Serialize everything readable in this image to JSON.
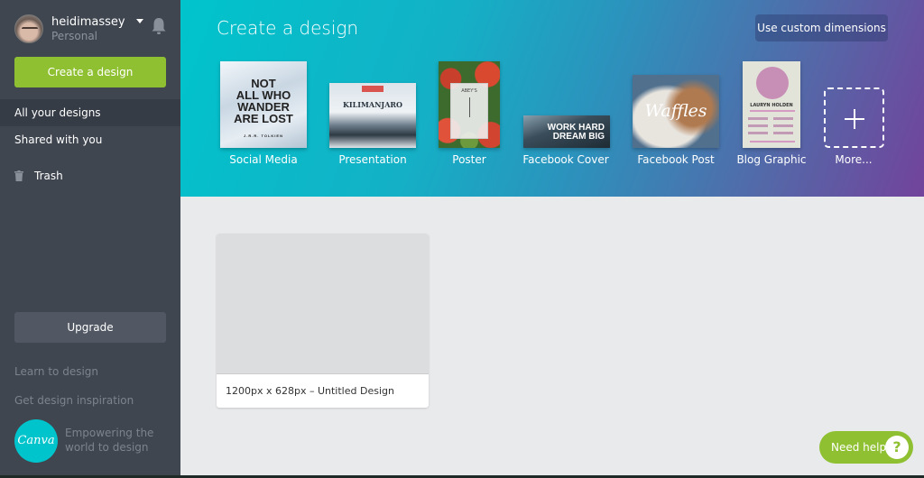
{
  "user": {
    "name": "heidimassey",
    "plan": "Personal"
  },
  "sidebar": {
    "create_label": "Create a design",
    "items": [
      {
        "label": "All your designs",
        "active": true
      },
      {
        "label": "Shared with you",
        "active": false
      },
      {
        "label": "Trash",
        "icon": "trash-icon"
      }
    ],
    "upgrade_label": "Upgrade",
    "links": [
      "Learn to design",
      "Get design inspiration"
    ],
    "logo_text": "Canva",
    "tagline": "Empowering the world to design"
  },
  "banner": {
    "title": "Create a design",
    "custom_dimensions_label": "Use custom dimensions",
    "templates": [
      {
        "label": "Social Media",
        "thumb_text": [
          "NOT",
          "ALL WHO",
          "WANDER",
          "ARE LOST"
        ],
        "thumb_sub": "J.R.R. TOLKIEN"
      },
      {
        "label": "Presentation",
        "thumb_text": "KILIMANJARO"
      },
      {
        "label": "Poster",
        "thumb_text": "ABEY'S"
      },
      {
        "label": "Facebook Cover",
        "thumb_text": [
          "WORK HARD",
          "DREAM BIG"
        ]
      },
      {
        "label": "Facebook Post",
        "thumb_text": "Waffles"
      },
      {
        "label": "Blog Graphic",
        "thumb_text": "LAURYN HOLDEN"
      },
      {
        "label": "More...",
        "icon": "plus-icon"
      }
    ]
  },
  "designs": [
    {
      "title": "1200px x 628px – Untitled Design"
    }
  ],
  "help": {
    "label": "Need help",
    "icon_glyph": "?"
  },
  "colors": {
    "accent_green": "#8fc031",
    "sidebar_bg": "#3f4650",
    "brand_teal": "#00c4cc"
  }
}
